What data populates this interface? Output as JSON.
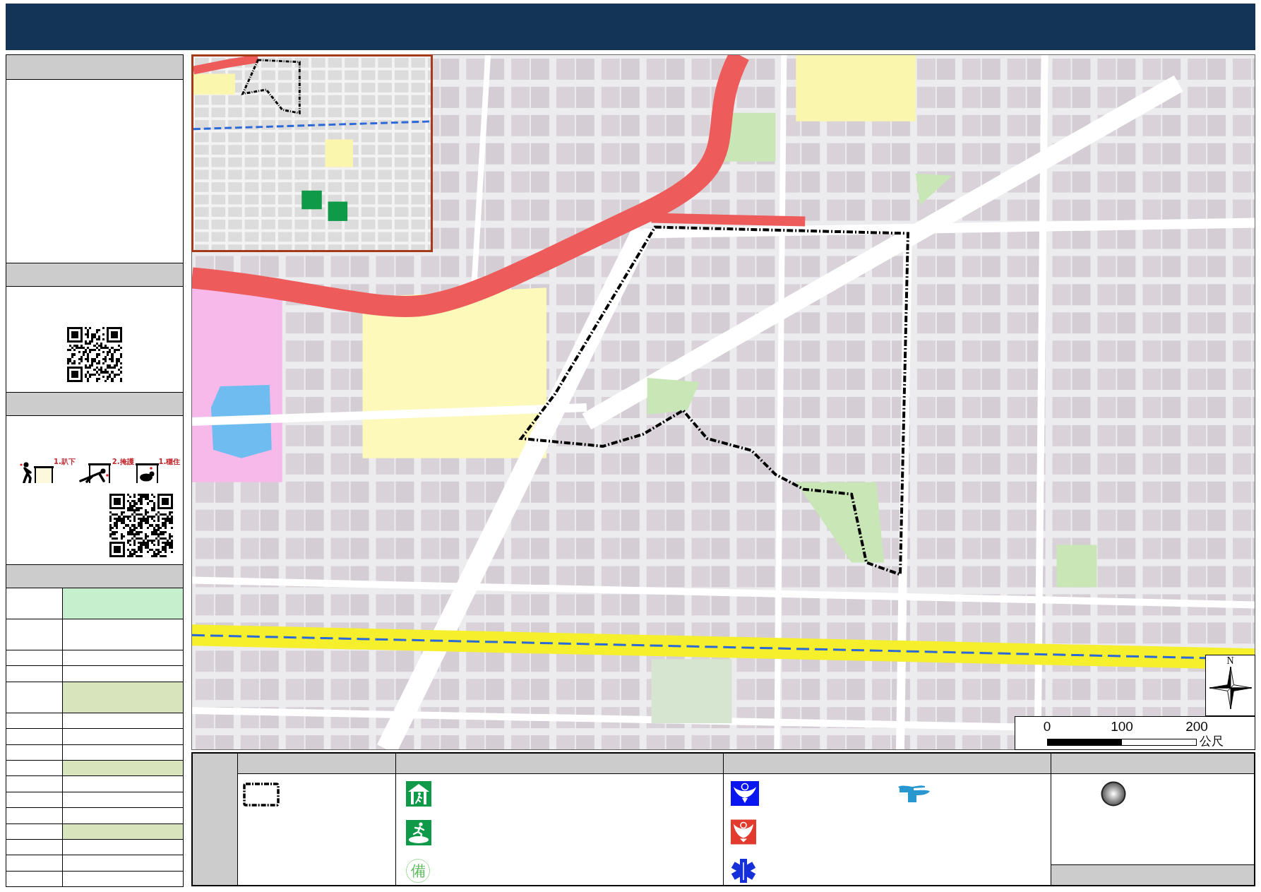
{
  "sidebar": {
    "safety_steps": [
      {
        "kind": "drop",
        "label": "1.趴下"
      },
      {
        "kind": "cover",
        "label": "2.掩護"
      },
      {
        "kind": "hold",
        "label": "1.穩住"
      }
    ],
    "info_table": {
      "rows": [
        {
          "color": "#c6efce"
        },
        {
          "color": "#ffffff"
        },
        {
          "color": "#ffffff"
        },
        {
          "color": "#ffffff"
        },
        {
          "color": "#d8e4bc"
        },
        {
          "color": "#ffffff"
        },
        {
          "color": "#ffffff"
        },
        {
          "color": "#ffffff"
        },
        {
          "color": "#d8e4bc"
        },
        {
          "color": "#ffffff"
        },
        {
          "color": "#ffffff"
        },
        {
          "color": "#ffffff"
        },
        {
          "color": "#d8e4bc"
        },
        {
          "color": "#ffffff"
        },
        {
          "color": "#ffffff"
        },
        {
          "color": "#ffffff"
        }
      ]
    }
  },
  "map": {
    "north_arrow": {
      "label": "N"
    },
    "scale_bar": {
      "ticks": [
        "0",
        "100",
        "200"
      ],
      "unit": "公尺"
    }
  },
  "legend": {
    "standby_symbol": "備"
  }
}
